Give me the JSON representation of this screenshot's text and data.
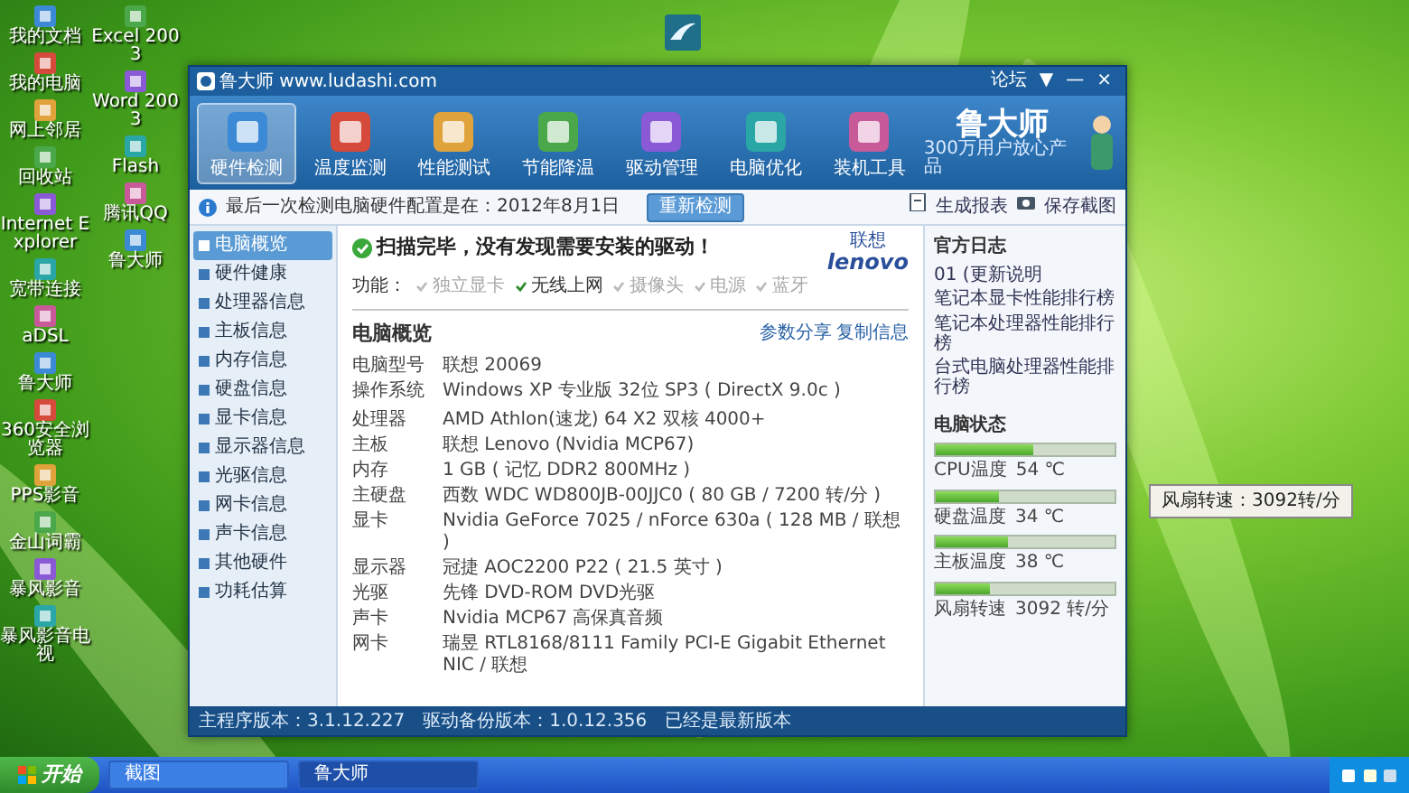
{
  "desktop": {
    "icon_columns": [
      {
        "icons": [
          "我的文档",
          "我的电脑",
          "网上邻居",
          "回收站",
          "Internet Explorer",
          "宽带连接",
          "aDSL",
          "鲁大师",
          "360安全浏览器",
          "PPS影音",
          "金山词霸",
          "暴风影音",
          "暴风影音电视"
        ]
      },
      {
        "icons": [
          "Excel 2003",
          "Word 2003",
          "Flash",
          "腾讯QQ",
          "鲁大师"
        ]
      }
    ]
  },
  "window": {
    "title": "鲁大师 www.ludashi.com",
    "controls": [
      "论坛",
      "▼",
      "—",
      "×"
    ],
    "tabs": [
      {
        "label": "硬件检测",
        "selected": true
      },
      {
        "label": "温度监测",
        "selected": false
      },
      {
        "label": "性能测试",
        "selected": false
      },
      {
        "label": "节能降温",
        "selected": false
      },
      {
        "label": "驱动管理",
        "selected": false
      },
      {
        "label": "电脑优化",
        "selected": false
      },
      {
        "label": "装机工具",
        "selected": false
      }
    ],
    "logo": {
      "name": "鲁大师",
      "tagline": "300万用户放心产品"
    },
    "info_bar": {
      "text": "最后一次检测电脑硬件配置是在：2012年8月1日",
      "button": "重新检测",
      "actions": [
        "生成报表",
        "保存截图"
      ]
    },
    "sidebar": {
      "items": [
        {
          "label": "电脑概览",
          "selected": true
        },
        {
          "label": "硬件健康",
          "selected": false
        },
        {
          "label": "处理器信息",
          "selected": false
        },
        {
          "label": "主板信息",
          "selected": false
        },
        {
          "label": "内存信息",
          "selected": false
        },
        {
          "label": "硬盘信息",
          "selected": false
        },
        {
          "label": "显卡信息",
          "selected": false
        },
        {
          "label": "显示器信息",
          "selected": false
        },
        {
          "label": "光驱信息",
          "selected": false
        },
        {
          "label": "网卡信息",
          "selected": false
        },
        {
          "label": "声卡信息",
          "selected": false
        },
        {
          "label": "其他硬件",
          "selected": false
        },
        {
          "label": "功耗估算",
          "selected": false
        }
      ]
    },
    "scan_message": "扫描完毕，没有发现需要安装的驱动！",
    "features_label": "功能：",
    "features": [
      {
        "label": "独立显卡",
        "available": false
      },
      {
        "label": "无线上网",
        "available": true
      },
      {
        "label": "摄像头",
        "available": false
      },
      {
        "label": "电源",
        "available": false
      },
      {
        "label": "蓝牙",
        "available": false
      }
    ],
    "brand_logo": {
      "top": "联想",
      "bottom": "lenovo"
    },
    "overview": {
      "title": "电脑概览",
      "links": [
        "参数分享",
        "复制信息"
      ],
      "rows": [
        {
          "label": "电脑型号",
          "value": "联想 20069"
        },
        {
          "label": "操作系统",
          "value": "Windows XP 专业版 32位 SP3 ( DirectX 9.0c )"
        },
        {
          "label": "处理器",
          "value": "AMD Athlon(速龙) 64 X2 双核 4000+"
        },
        {
          "label": "主板",
          "value": "联想 Lenovo (Nvidia MCP67)"
        },
        {
          "label": "内存",
          "value": "1 GB ( 记忆 DDR2 800MHz )"
        },
        {
          "label": "主硬盘",
          "value": "西数 WDC WD800JB-00JJC0 ( 80 GB / 7200 转/分 )"
        },
        {
          "label": "显卡",
          "value": "Nvidia GeForce 7025 / nForce 630a ( 128 MB / 联想 )"
        },
        {
          "label": "显示器",
          "value": "冠捷 AOC2200 P22 ( 21.5 英寸 )"
        },
        {
          "label": "光驱",
          "value": "先锋 DVD-ROM DVD光驱"
        },
        {
          "label": "声卡",
          "value": "Nvidia MCP67 高保真音频"
        },
        {
          "label": "网卡",
          "value": "瑞昱 RTL8168/8111 Family PCI-E Gigabit Ethernet NIC / 联想"
        }
      ]
    },
    "news": {
      "title": "官方日志",
      "items": [
        "01 (更新说明",
        "笔记本显卡性能排行榜",
        "笔记本处理器性能排行榜",
        "台式电脑处理器性能排行榜"
      ]
    },
    "status": {
      "title": "电脑状态",
      "meters": [
        {
          "label": "CPU温度",
          "reading": "54 ℃",
          "level": 0.55
        },
        {
          "label": "硬盘温度",
          "reading": "34 ℃",
          "level": 0.35
        },
        {
          "label": "主板温度",
          "reading": "38 ℃",
          "level": 0.4
        },
        {
          "label": "风扇转速",
          "reading": "3092 转/分",
          "level": 0.3
        }
      ]
    },
    "status_bar": [
      "主程序版本：3.1.12.227",
      "驱动备份版本：1.0.12.356",
      "已经是最新版本"
    ]
  },
  "tooltip": {
    "text": "风扇转速：3092转/分"
  },
  "taskbar": {
    "start": "开始",
    "tasks": [
      {
        "label": "截图",
        "selected": false
      },
      {
        "label": "鲁大师",
        "selected": true
      }
    ]
  }
}
